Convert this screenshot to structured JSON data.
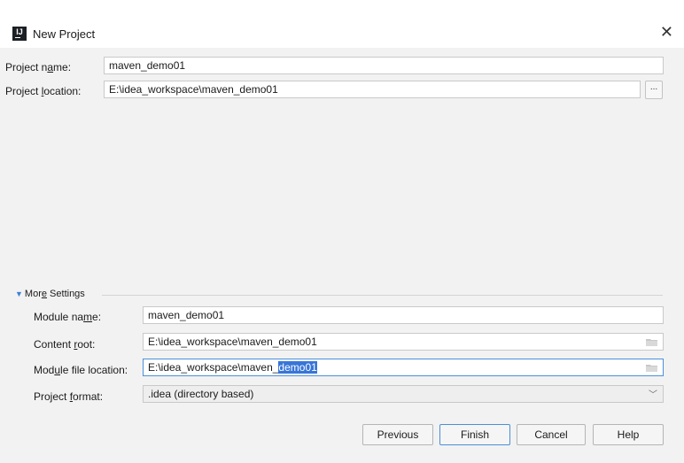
{
  "window": {
    "title": "New Project",
    "close_glyph": "✕",
    "app_icon_text": "IJ"
  },
  "form": {
    "project_name": {
      "label_pre": "Project n",
      "label_mn": "a",
      "label_post": "me:",
      "value": "maven_demo01"
    },
    "project_location": {
      "label_pre": "Project ",
      "label_mn": "l",
      "label_post": "ocation:",
      "value": "E:\\idea_workspace\\maven_demo01",
      "browse_label": "..."
    }
  },
  "more_settings": {
    "header_pre": "Mor",
    "header_mn": "e",
    "header_post": " Settings",
    "module_name": {
      "label_pre": "Module na",
      "label_mn": "m",
      "label_post": "e:",
      "value": "maven_demo01"
    },
    "content_root": {
      "label_pre": "Content ",
      "label_mn": "r",
      "label_post": "oot:",
      "value": "E:\\idea_workspace\\maven_demo01"
    },
    "module_file_location": {
      "label_pre": "Mod",
      "label_mn": "u",
      "label_post": "le file location:",
      "value_plain": "E:\\idea_workspace\\maven_",
      "value_selected": "demo01"
    },
    "project_format": {
      "label_pre": "Project ",
      "label_mn": "f",
      "label_post": "ormat:",
      "value": ".idea (directory based)"
    }
  },
  "buttons": {
    "previous": "Previous",
    "finish": "Finish",
    "cancel": "Cancel",
    "help": "Help"
  },
  "colors": {
    "selection": "#3875d7",
    "focus_border": "#4a90d9",
    "accent_triangle": "#3d7fd6",
    "dialog_bg": "#f2f2f2"
  },
  "icons": {
    "app": "intellij-idea-icon",
    "close": "close-icon",
    "folder": "folder-icon",
    "collapse": "triangle-down-icon",
    "dropdown": "chevron-down-icon"
  }
}
